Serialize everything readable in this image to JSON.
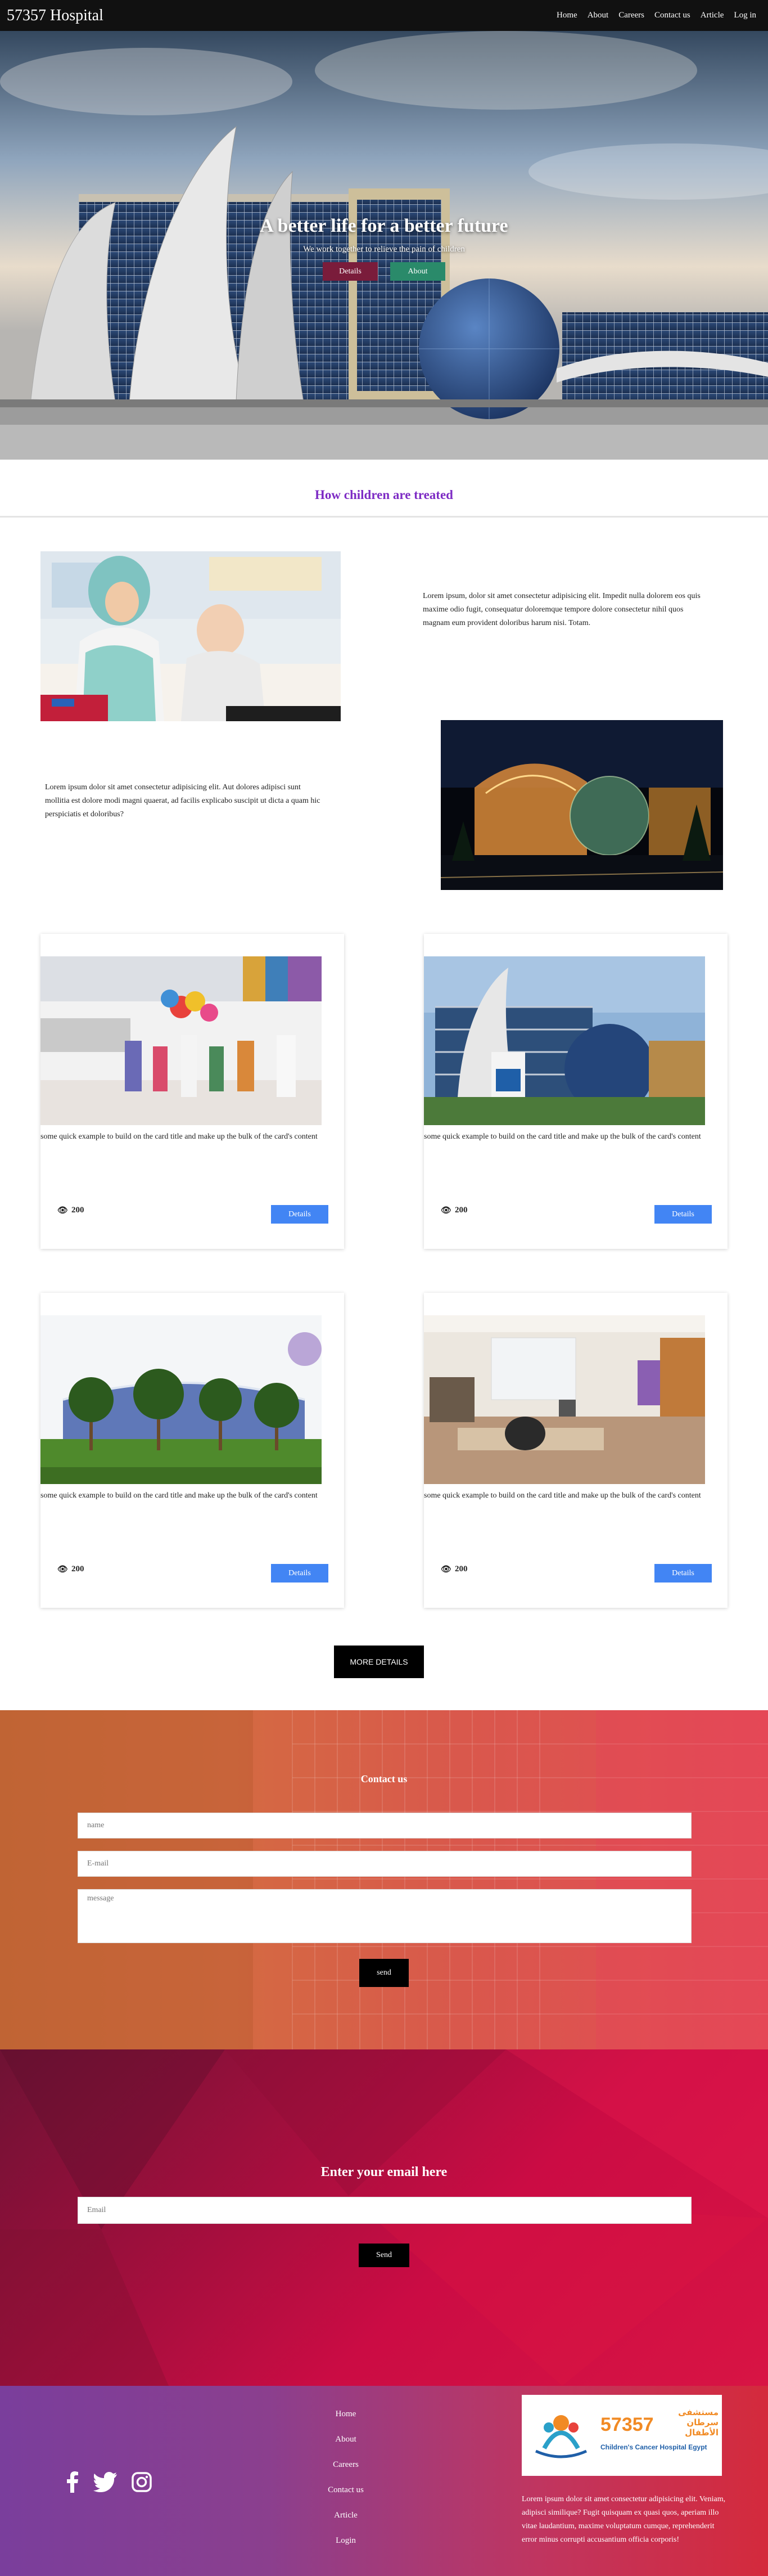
{
  "nav": {
    "brand": "57357 Hospital",
    "links": [
      "Home",
      "About",
      "Careers",
      "Contact us",
      "Article",
      "Log in"
    ]
  },
  "hero": {
    "title": "A better life for a better future",
    "subtitle": "We work together to relieve the pain of children",
    "details_label": "Details",
    "about_label": "About"
  },
  "section": {
    "title": "How children are treated"
  },
  "feature1": {
    "text": "Lorem ipsum, dolor sit amet consectetur adipisicing elit. Impedit nulla dolorem eos quis maxime odio fugit, consequatur doloremque tempore dolore consectetur nihil quos magnam eum provident doloribus harum nisi. Totam."
  },
  "feature2": {
    "text": "Lorem ipsum dolor sit amet consectetur adipisicing elit. Aut dolores adipisci sunt mollitia est dolore modi magni quaerat, ad facilis explicabo suscipit ut dicta a quam hic perspiciatis et doloribus?"
  },
  "cards": [
    {
      "text": "some quick example to build on the card title and make up the bulk of the card's content",
      "views": "200",
      "button": "Details"
    },
    {
      "text": "some quick example to build on the card title and make up the bulk of the card's content",
      "views": "200",
      "button": "Details"
    },
    {
      "text": "some quick example to build on the card title and make up the bulk of the card's content",
      "views": "200",
      "button": "Details"
    },
    {
      "text": "some quick example to build on the card title and make up the bulk of the card's content",
      "views": "200",
      "button": "Details"
    }
  ],
  "more_button": "MORE DETAILS",
  "contact": {
    "title": "Contact us",
    "name_placeholder": "name",
    "email_placeholder": "E-mail",
    "message_placeholder": "message",
    "send_label": "send"
  },
  "newsletter": {
    "title": "Enter your email here",
    "email_placeholder": "Email",
    "send_label": "Send"
  },
  "footer": {
    "links": [
      "Home",
      "About",
      "Careers",
      "Contact us",
      "Article",
      "Login"
    ],
    "logo_number": "57357",
    "logo_arabic": "مستشفى سرطان الأطفال",
    "logo_english": "Children's Cancer Hospital Egypt",
    "text": "Lorem ipsum dolor sit amet consectetur adipisicing elit. Veniam, adipisci similique? Fugit quisquam ex quasi quos, aperiam illo vitae laudantium, maxime voluptatum cumque, reprehenderit error minus corrupti accusantium officia corporis!",
    "social": [
      "facebook-icon",
      "twitter-icon",
      "instagram-icon"
    ]
  },
  "colors": {
    "navbar": "#111111",
    "section_title": "#7d2bc4",
    "card_button": "#4285f4",
    "hero_details": "#7a1c3b",
    "hero_about": "#2a8a6a"
  }
}
